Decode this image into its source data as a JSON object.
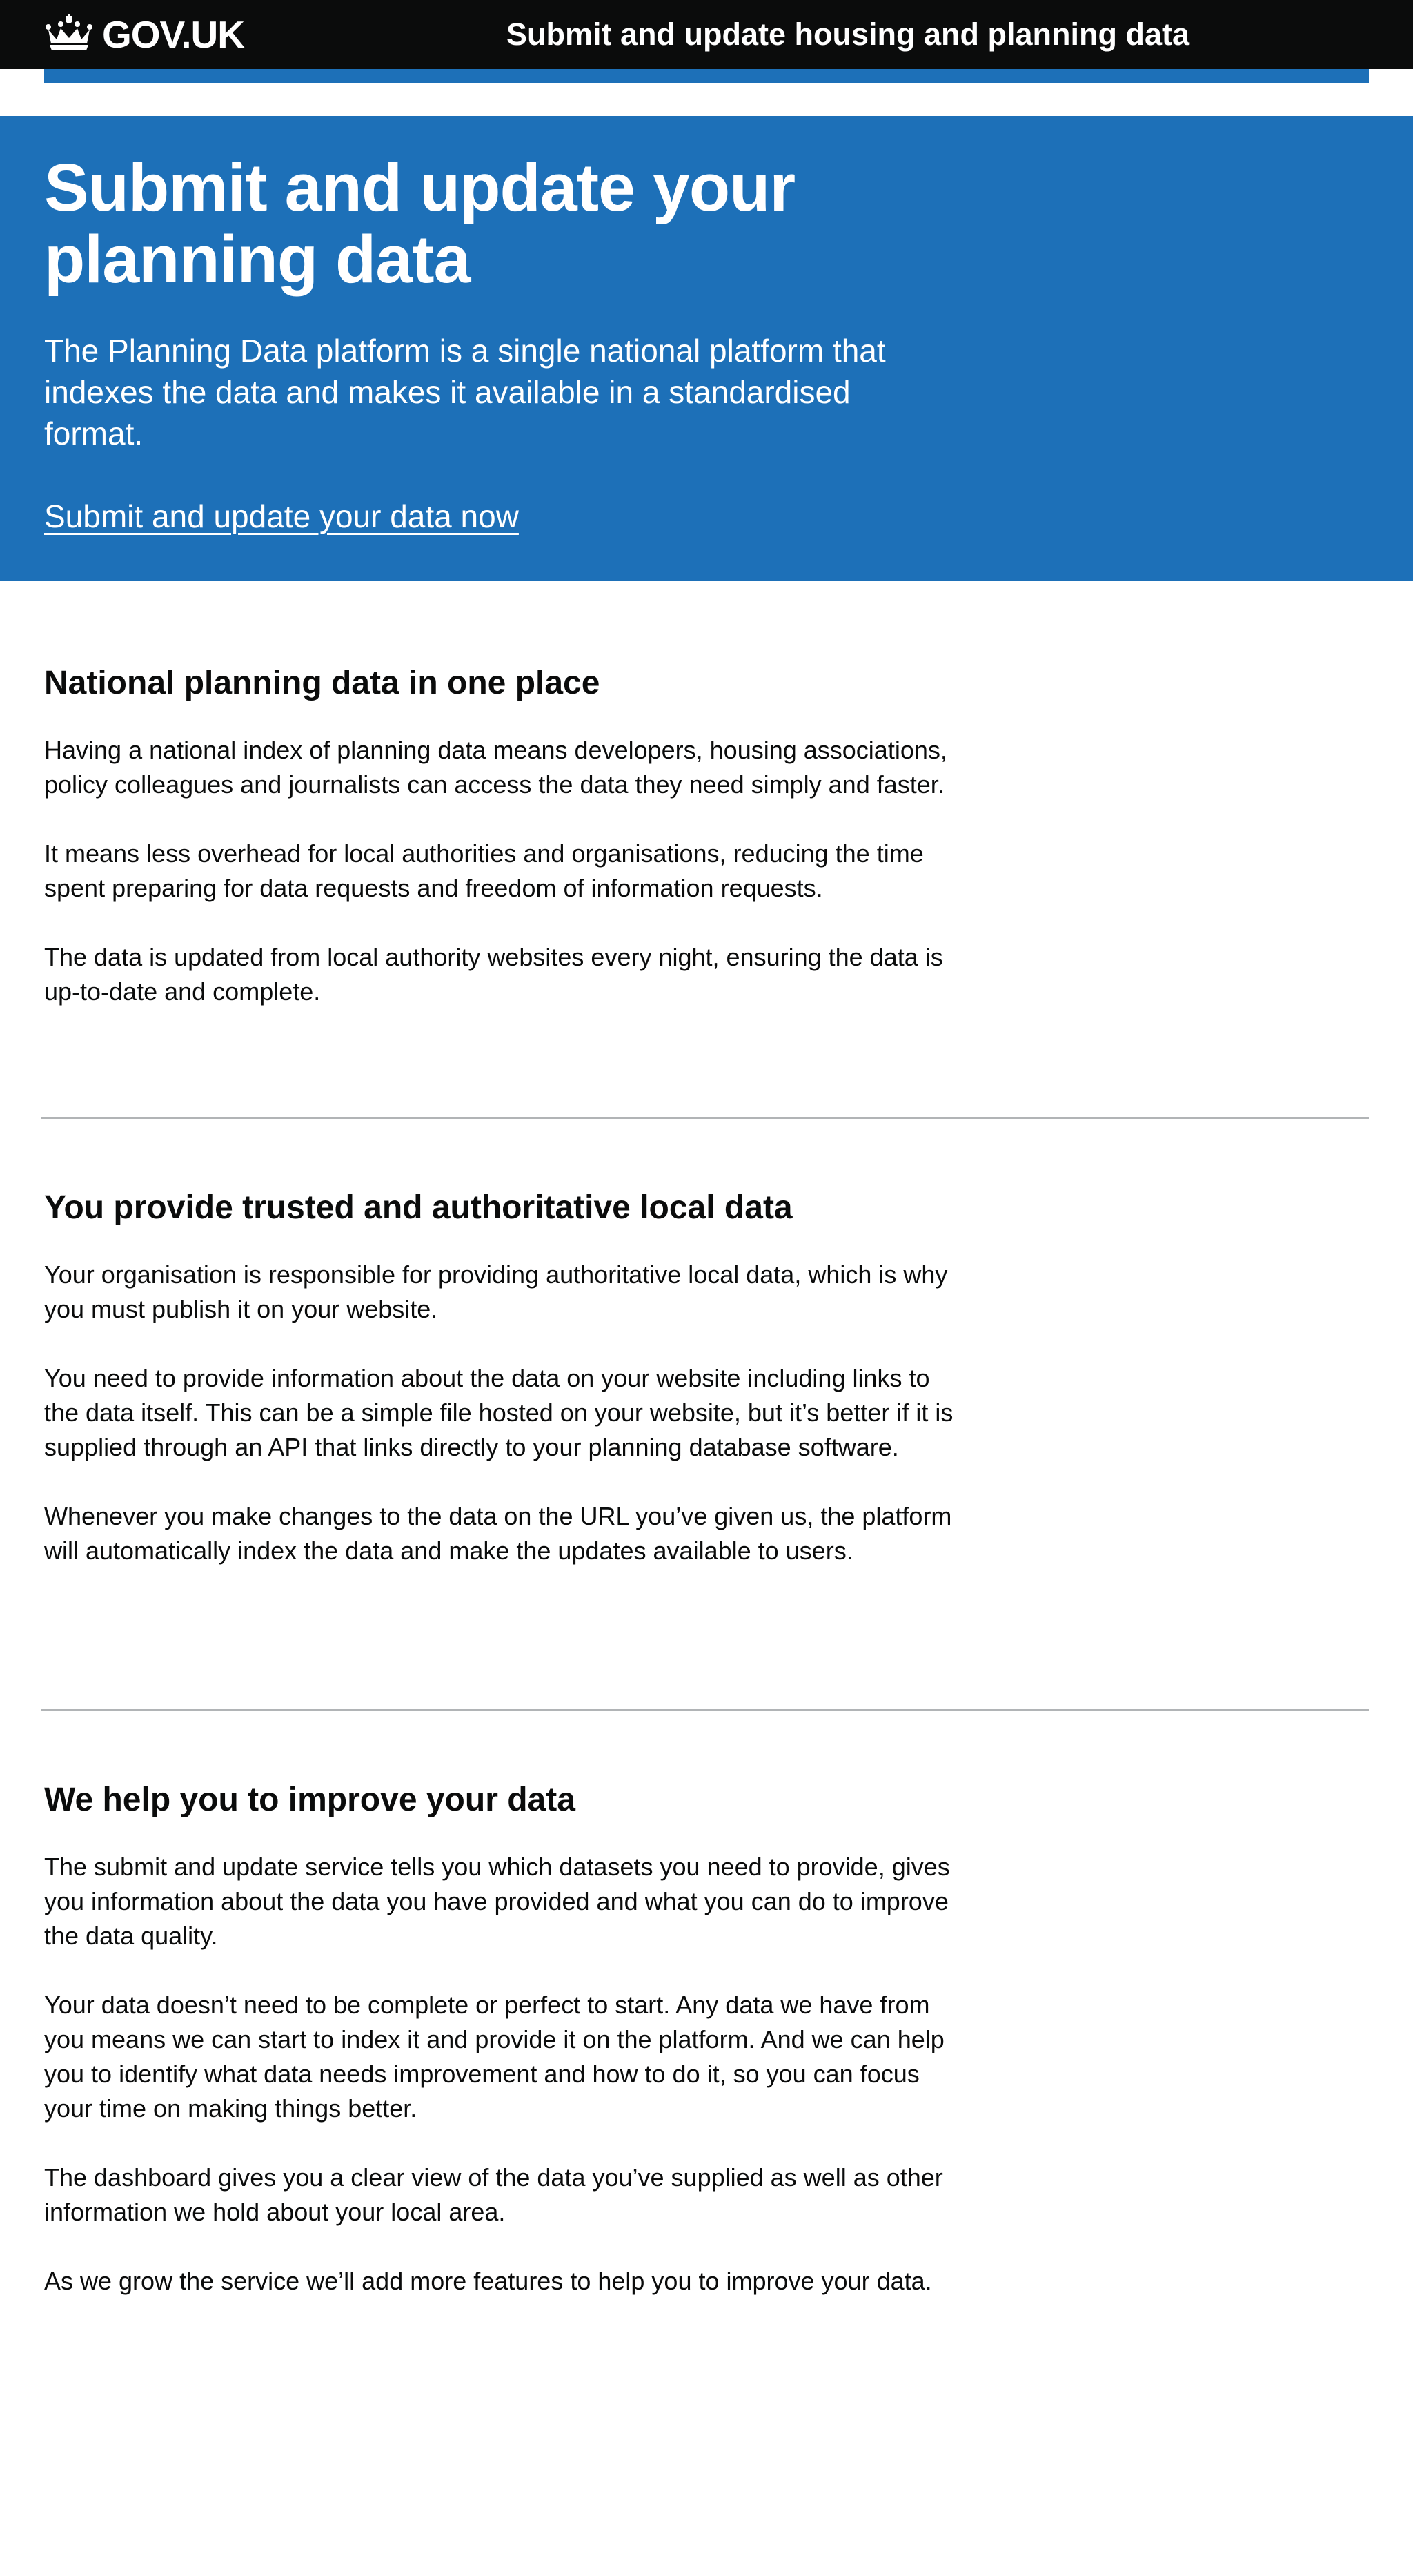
{
  "header": {
    "logo_text": "GOV.UK",
    "logo_icon": "crown-icon",
    "service_name": "Submit and update housing and planning data"
  },
  "hero": {
    "title": "Submit and update your planning data",
    "lead": "The Planning Data platform is a single national platform that indexes the data and makes it available in a standardised format.",
    "cta_link": "Submit and update your data now"
  },
  "sections": [
    {
      "heading": "National planning data in one place",
      "paragraphs": [
        "Having a national index of planning data means developers, housing associations, policy colleagues and journalists can access the data they need simply and faster.",
        "It means less overhead for local authorities and organisations, reducing the time spent preparing for data requests and freedom of information requests.",
        "The data is updated from local authority websites every night, ensuring the data is up-to-date and complete."
      ]
    },
    {
      "heading": "You provide trusted and authoritative local data",
      "paragraphs": [
        "Your organisation is responsible for providing authoritative local data, which is why you must publish it on your website.",
        "You need to provide information about the data on your website including links to the data itself. This can be a simple file hosted on your website, but it’s better if it is supplied through an API that links directly to your planning database software.",
        "Whenever you make changes to the data on the URL you’ve given us, the platform will automatically index the data and make the updates available to users."
      ]
    },
    {
      "heading": "We help you to improve your data",
      "paragraphs": [
        "The submit and update service tells you which datasets you need to provide, gives you information about the data you have provided and what you can do to improve the data quality.",
        "Your data doesn’t need to be complete or perfect to start. Any data we have from you means we can start to index it and provide it on the platform. And we can help you to identify what data needs improvement and how to do it, so you can focus your time on making things better.",
        "The dashboard gives you a clear view of the data you’ve supplied as well as other information we hold about your local area.",
        "As we grow the service we’ll add more features to help you to improve your data."
      ]
    }
  ],
  "colors": {
    "header_bg": "#0b0c0c",
    "brand_blue": "#1d70b8",
    "text": "#0b0c0c",
    "divider": "#b1b4b6"
  }
}
